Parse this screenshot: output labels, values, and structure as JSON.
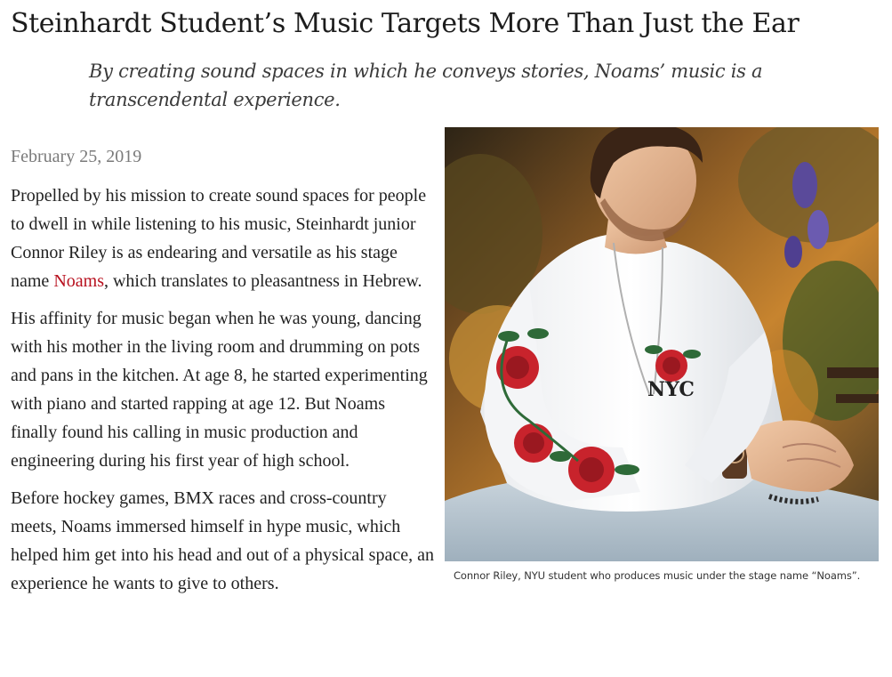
{
  "article": {
    "title": "Steinhardt Student’s Music Targets More Than Just the Ear",
    "subtitle": "By creating sound spaces in which he conveys stories, Noams’ music is a transcendental experience.",
    "date": "February 25, 2019",
    "paragraph1": {
      "before_link": "Propelled by his mission to create sound spaces for people to dwell in while listening to his music, Steinhardt junior Connor Riley is as endearing and versatile as his stage name ",
      "link_text": "Noams",
      "after_link": ", which translates to pleasantness in Hebrew."
    },
    "paragraph2": "His affinity for music began when he was young, dancing with his mother in the living room and drumming on pots and pans in the kitchen. At age 8, he started experimenting with piano and started rapping at age 12. But Noams finally found his calling in music production and engineering during his first year of high school.",
    "paragraph3": "Before hockey games, BMX races and cross-country meets, Noams immersed himself in hype music, which helped him get into his head and out of a physical space, an experience he wants to give to others.",
    "photo": {
      "caption": "Connor Riley, NYU student who produces music under the stage name “Noams”.",
      "shirt_text": "NYC"
    }
  },
  "colors": {
    "link": "#b8101e",
    "date": "#7a7a7a",
    "text": "#222222"
  }
}
